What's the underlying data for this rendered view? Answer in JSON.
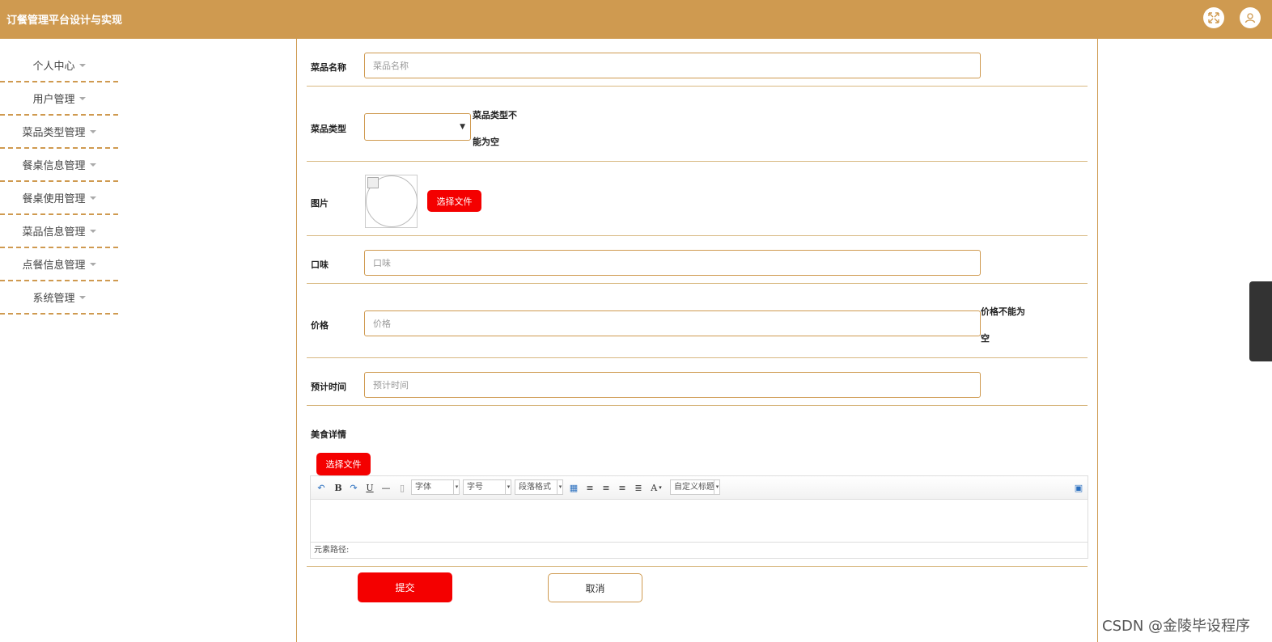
{
  "header": {
    "title": "订餐管理平台设计与实现",
    "fullscreen_icon": "expand-arrows-icon",
    "user_icon": "user-icon"
  },
  "sidebar": {
    "items": [
      {
        "label": "个人中心"
      },
      {
        "label": "用户管理"
      },
      {
        "label": "菜品类型管理"
      },
      {
        "label": "餐桌信息管理"
      },
      {
        "label": "餐桌使用管理"
      },
      {
        "label": "菜品信息管理"
      },
      {
        "label": "点餐信息管理"
      },
      {
        "label": "系统管理"
      }
    ]
  },
  "form": {
    "name": {
      "label": "菜品名称",
      "placeholder": "菜品名称",
      "value": ""
    },
    "type": {
      "label": "菜品类型",
      "value": "",
      "error_line1": "菜品类型不",
      "error_line2": "能为空"
    },
    "image": {
      "label": "图片",
      "upload_label": "选择文件"
    },
    "taste": {
      "label": "口味",
      "placeholder": "口味",
      "value": ""
    },
    "price": {
      "label": "价格",
      "placeholder": "价格",
      "value": "",
      "error_line1": "价格不能为",
      "error_line2": "空"
    },
    "time": {
      "label": "预计时间",
      "placeholder": "预计时间",
      "value": ""
    },
    "detail": {
      "label": "美食详情",
      "upload_label": "选择文件"
    }
  },
  "editor": {
    "font_family": "字体",
    "font_size": "字号",
    "paragraph": "段落格式",
    "custom_title": "自定义标题",
    "path_label": "元素路径:",
    "bold": "B",
    "underline": "U",
    "font_color": "A"
  },
  "actions": {
    "submit": "提交",
    "cancel": "取消"
  },
  "watermark": "CSDN @金陵毕设程序",
  "colors": {
    "brand": "#cf9a50",
    "danger": "#f40000"
  }
}
